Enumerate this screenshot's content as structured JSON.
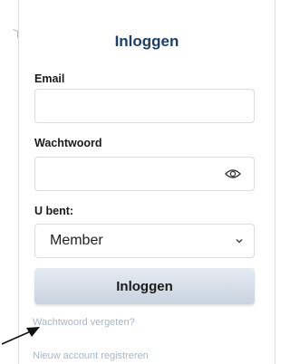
{
  "login": {
    "title": "Inloggen",
    "email_label": "Email",
    "email_value": "",
    "password_label": "Wachtwoord",
    "password_value": "",
    "role_label": "U bent:",
    "role_selected": "Member",
    "submit_label": "Inloggen",
    "forgot_link": "Wachtwoord vergeten?",
    "register_link": "Nieuw account registreren"
  },
  "icons": {
    "password_toggle": "eye-icon",
    "select_caret": "chevron-down-icon",
    "annotation": "arrow-icon"
  },
  "colors": {
    "title": "#1d3f6e",
    "link": "#a9b6c6",
    "button_gradient_top": "#e5ebf2",
    "button_gradient_bottom": "#c9d3de",
    "field_border": "#dcdcdc"
  }
}
